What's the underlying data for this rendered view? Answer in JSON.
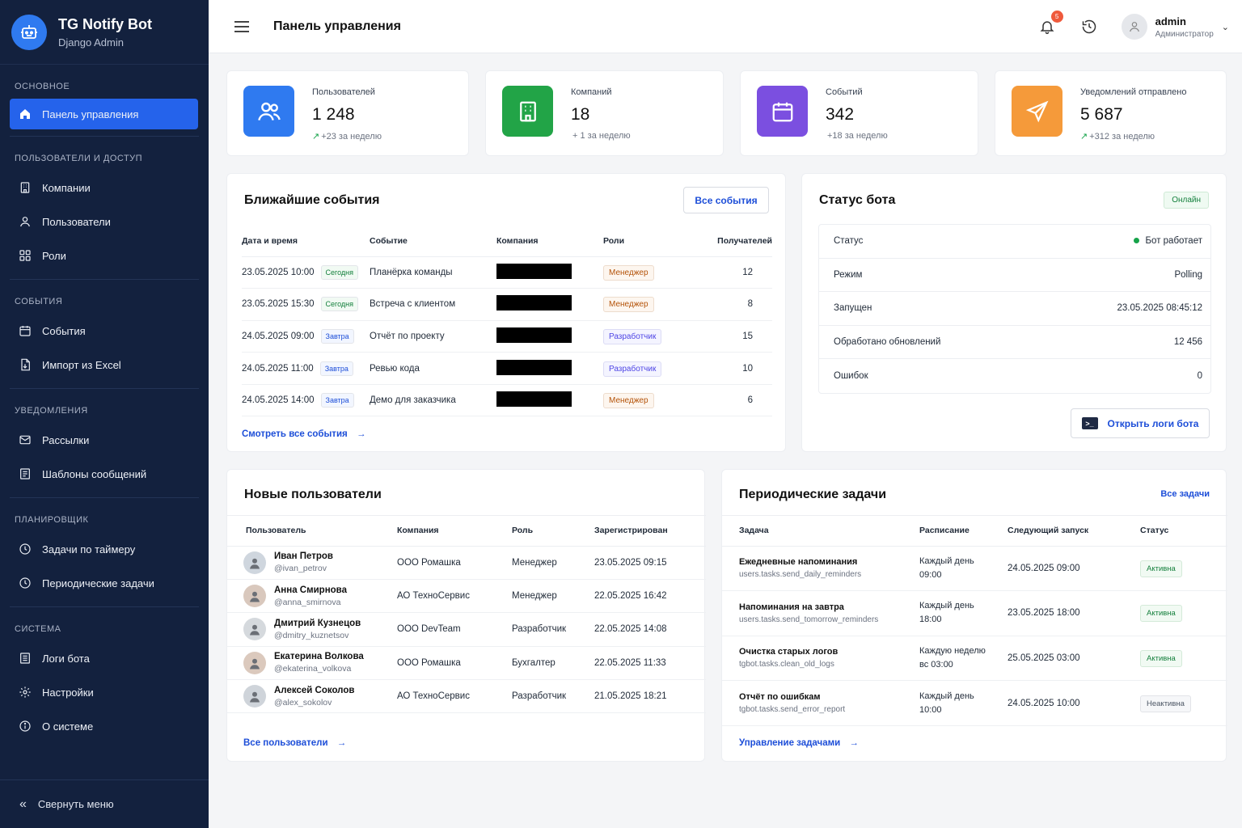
{
  "brand": {
    "title": "TG Notify Bot",
    "subtitle": "Django Admin"
  },
  "sidebar": {
    "sections": [
      {
        "title": "ОСНОВНОЕ",
        "items": [
          {
            "label": "Панель управления",
            "icon": "home-icon",
            "active": true
          }
        ]
      },
      {
        "title": "ПОЛЬЗОВАТЕЛИ И ДОСТУП",
        "items": [
          {
            "label": "Компании",
            "icon": "building-icon"
          },
          {
            "label": "Пользователи",
            "icon": "user-icon"
          },
          {
            "label": "Роли",
            "icon": "grid-icon"
          }
        ]
      },
      {
        "title": "СОБЫТИЯ",
        "items": [
          {
            "label": "События",
            "icon": "calendar-icon"
          },
          {
            "label": "Импорт из Excel",
            "icon": "file-import-icon"
          }
        ]
      },
      {
        "title": "УВЕДОМЛЕНИЯ",
        "items": [
          {
            "label": "Рассылки",
            "icon": "mail-icon"
          },
          {
            "label": "Шаблоны сообщений",
            "icon": "template-icon"
          }
        ]
      },
      {
        "title": "ПЛАНИРОВЩИК",
        "items": [
          {
            "label": "Задачи по таймеру",
            "icon": "clock-icon"
          },
          {
            "label": "Периодические задачи",
            "icon": "clock-icon"
          }
        ]
      },
      {
        "title": "СИСТЕМА",
        "items": [
          {
            "label": "Логи бота",
            "icon": "log-icon"
          },
          {
            "label": "Настройки",
            "icon": "gear-icon"
          },
          {
            "label": "О системе",
            "icon": "info-icon"
          }
        ]
      }
    ],
    "collapse_label": "Свернуть меню"
  },
  "topbar": {
    "title": "Панель управления",
    "notifications": "5",
    "user_name": "admin",
    "user_role": "Администратор"
  },
  "stats": [
    {
      "label": "Пользователей",
      "value": "1 248",
      "delta": "+23 за неделю",
      "arrow": "↗",
      "color": "#2f7af0",
      "icon": "users-icon"
    },
    {
      "label": "Компаний",
      "value": "18",
      "delta": "+ 1 за неделю",
      "arrow": "",
      "color": "#22a447",
      "icon": "building-icon"
    },
    {
      "label": "Событий",
      "value": "342",
      "delta": "+18 за неделю",
      "arrow": "",
      "color": "#7b4fe0",
      "icon": "calendar-icon"
    },
    {
      "label": "Уведомлений отправлено",
      "value": "5 687",
      "delta": "+312 за неделю",
      "arrow": "↗",
      "color": "#f59a3a",
      "icon": "send-icon"
    }
  ],
  "events": {
    "title": "Ближайшие события",
    "all_button": "Все события",
    "columns": [
      "Дата и время",
      "Событие",
      "Компания",
      "Роли",
      "Получателей"
    ],
    "rows": [
      {
        "date": "23.05.2025 10:00",
        "tag": "Сегодня",
        "tag_kind": "green",
        "event": "Планёрка команды",
        "role": "Менеджер",
        "role_kind": "man",
        "count": "12"
      },
      {
        "date": "23.05.2025 15:30",
        "tag": "Сегодня",
        "tag_kind": "green",
        "event": "Встреча с клиентом",
        "role": "Менеджер",
        "role_kind": "man",
        "count": "8"
      },
      {
        "date": "24.05.2025 09:00",
        "tag": "Завтра",
        "tag_kind": "blue",
        "event": "Отчёт по проекту",
        "role": "Разработчик",
        "role_kind": "dev",
        "count": "15"
      },
      {
        "date": "24.05.2025 11:00",
        "tag": "Завтра",
        "tag_kind": "blue",
        "event": "Ревью кода",
        "role": "Разработчик",
        "role_kind": "dev",
        "count": "10"
      },
      {
        "date": "24.05.2025 14:00",
        "tag": "Завтра",
        "tag_kind": "blue",
        "event": "Демо для заказчика",
        "role": "Менеджер",
        "role_kind": "man",
        "count": "6"
      }
    ],
    "footer_link": "Смотреть все события"
  },
  "bot_status": {
    "title": "Статус бота",
    "badge": "Онлайн",
    "rows": [
      {
        "label": "Статус",
        "value": "Бот работает"
      },
      {
        "label": "Режим",
        "value": "Polling"
      },
      {
        "label": "Запущен",
        "value": "23.05.2025 08:45:12"
      },
      {
        "label": "Обработано обновлений",
        "value": "12 456"
      },
      {
        "label": "Ошибок",
        "value": "0"
      }
    ],
    "logs_button": "Открыть логи бота"
  },
  "new_users": {
    "title": "Новые пользователи",
    "columns": [
      "Пользователь",
      "Компания",
      "Роль",
      "Зарегистрирован"
    ],
    "rows": [
      {
        "name": "Иван Петров",
        "handle": "@ivan_petrov",
        "company": "ООО Ромашка",
        "role": "Менеджер",
        "date": "23.05.2025 09:15"
      },
      {
        "name": "Анна Смирнова",
        "handle": "@anna_smirnova",
        "company": "АО ТехноСервис",
        "role": "Менеджер",
        "date": "22.05.2025 16:42"
      },
      {
        "name": "Дмитрий Кузнецов",
        "handle": "@dmitry_kuznetsov",
        "company": "ООО DevTeam",
        "role": "Разработчик",
        "date": "22.05.2025 14:08"
      },
      {
        "name": "Екатерина Волкова",
        "handle": "@ekaterina_volkova",
        "company": "ООО Ромашка",
        "role": "Бухгалтер",
        "date": "22.05.2025 11:33"
      },
      {
        "name": "Алексей Соколов",
        "handle": "@alex_sokolov",
        "company": "АО ТехноСервис",
        "role": "Разработчик",
        "date": "21.05.2025 18:21"
      }
    ],
    "footer_link": "Все пользователи"
  },
  "tasks": {
    "title": "Периодические задачи",
    "all_link": "Все задачи",
    "columns": [
      "Задача",
      "Расписание",
      "Следующий запуск",
      "Статус"
    ],
    "rows": [
      {
        "name": "Ежедневные напоминания",
        "path": "users.tasks.send_daily_reminders",
        "sched1": "Каждый день",
        "sched2": "09:00",
        "next": "24.05.2025 09:00",
        "status": "Активна",
        "active": true
      },
      {
        "name": "Напоминания на завтра",
        "path": "users.tasks.send_tomorrow_reminders",
        "sched1": "Каждый день",
        "sched2": "18:00",
        "next": "23.05.2025 18:00",
        "status": "Активна",
        "active": true
      },
      {
        "name": "Очистка старых логов",
        "path": "tgbot.tasks.clean_old_logs",
        "sched1": "Каждую неделю",
        "sched2": "вс 03:00",
        "next": "25.05.2025 03:00",
        "status": "Активна",
        "active": true
      },
      {
        "name": "Отчёт по ошибкам",
        "path": "tgbot.tasks.send_error_report",
        "sched1": "Каждый день",
        "sched2": "10:00",
        "next": "24.05.2025 10:00",
        "status": "Неактивна",
        "active": false
      }
    ],
    "footer_link": "Управление задачами"
  }
}
